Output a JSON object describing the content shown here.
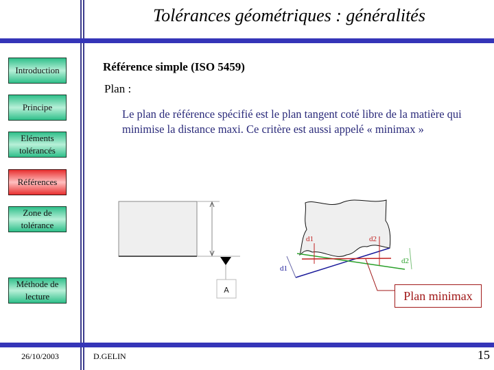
{
  "slide": {
    "title": "Tolérances géométriques : généralités",
    "heading": "Référence simple (ISO 5459)",
    "subheading": "Plan :",
    "paragraph": "Le plan de référence spécifié est le plan tangent coté libre de la matière qui minimise la distance maxi. Ce critère est aussi appelé « minimax »"
  },
  "sidebar": {
    "items": [
      {
        "label": "Introduction",
        "active": false
      },
      {
        "label": "Principe",
        "active": false
      },
      {
        "label": "Eléments tolérancés",
        "active": false
      },
      {
        "label": "Références",
        "active": true
      },
      {
        "label": "Zone de tolérance",
        "active": false
      },
      {
        "label": "Méthode de lecture",
        "active": false
      }
    ]
  },
  "diagram": {
    "datum_label": "A",
    "d1_label": "d1",
    "d2_label": "d2",
    "callout": "Plan minimax",
    "colors": {
      "callout": "#a01818",
      "blue_plane": "#1a1a9a",
      "green_plane": "#2aa02a",
      "red_plane": "#c02020"
    }
  },
  "footer": {
    "date": "26/10/2003",
    "author": "D.GELIN",
    "page": "15"
  },
  "colors": {
    "bar": "#3535b8",
    "nav_green": "#2fbf8a",
    "nav_red": "#e83030",
    "paragraph": "#2a2a7a"
  }
}
